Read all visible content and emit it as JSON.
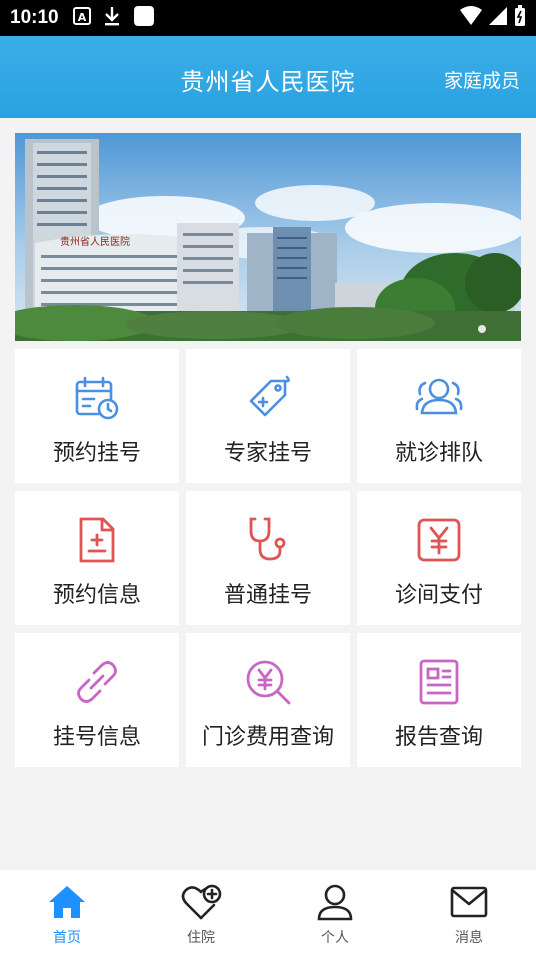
{
  "status_bar": {
    "time": "10:10"
  },
  "header": {
    "title": "贵州省人民医院",
    "family_link": "家庭成员"
  },
  "banner": {
    "building_sign": "贵州省人民医院"
  },
  "menu": [
    {
      "label": "预约挂号",
      "icon": "calendar-clock-icon",
      "color": "#4a90e2"
    },
    {
      "label": "专家挂号",
      "icon": "tag-plus-icon",
      "color": "#4a90e2"
    },
    {
      "label": "就诊排队",
      "icon": "users-icon",
      "color": "#4a90e2"
    },
    {
      "label": "预约信息",
      "icon": "document-plus-icon",
      "color": "#e05454"
    },
    {
      "label": "普通挂号",
      "icon": "stethoscope-icon",
      "color": "#e05454"
    },
    {
      "label": "诊间支付",
      "icon": "yuan-payment-icon",
      "color": "#e05454"
    },
    {
      "label": "挂号信息",
      "icon": "link-icon",
      "color": "#c966c4"
    },
    {
      "label": "门诊费用查询",
      "icon": "yuan-search-icon",
      "color": "#c966c4"
    },
    {
      "label": "报告查询",
      "icon": "report-icon",
      "color": "#c966c4"
    }
  ],
  "tabbar": [
    {
      "label": "首页",
      "icon": "home-icon",
      "active": true
    },
    {
      "label": "住院",
      "icon": "heart-plus-icon",
      "active": false
    },
    {
      "label": "个人",
      "icon": "person-icon",
      "active": false
    },
    {
      "label": "消息",
      "icon": "mail-icon",
      "active": false
    }
  ],
  "colors": {
    "header": "#2aa1e1",
    "tab_active": "#1e90ff"
  }
}
